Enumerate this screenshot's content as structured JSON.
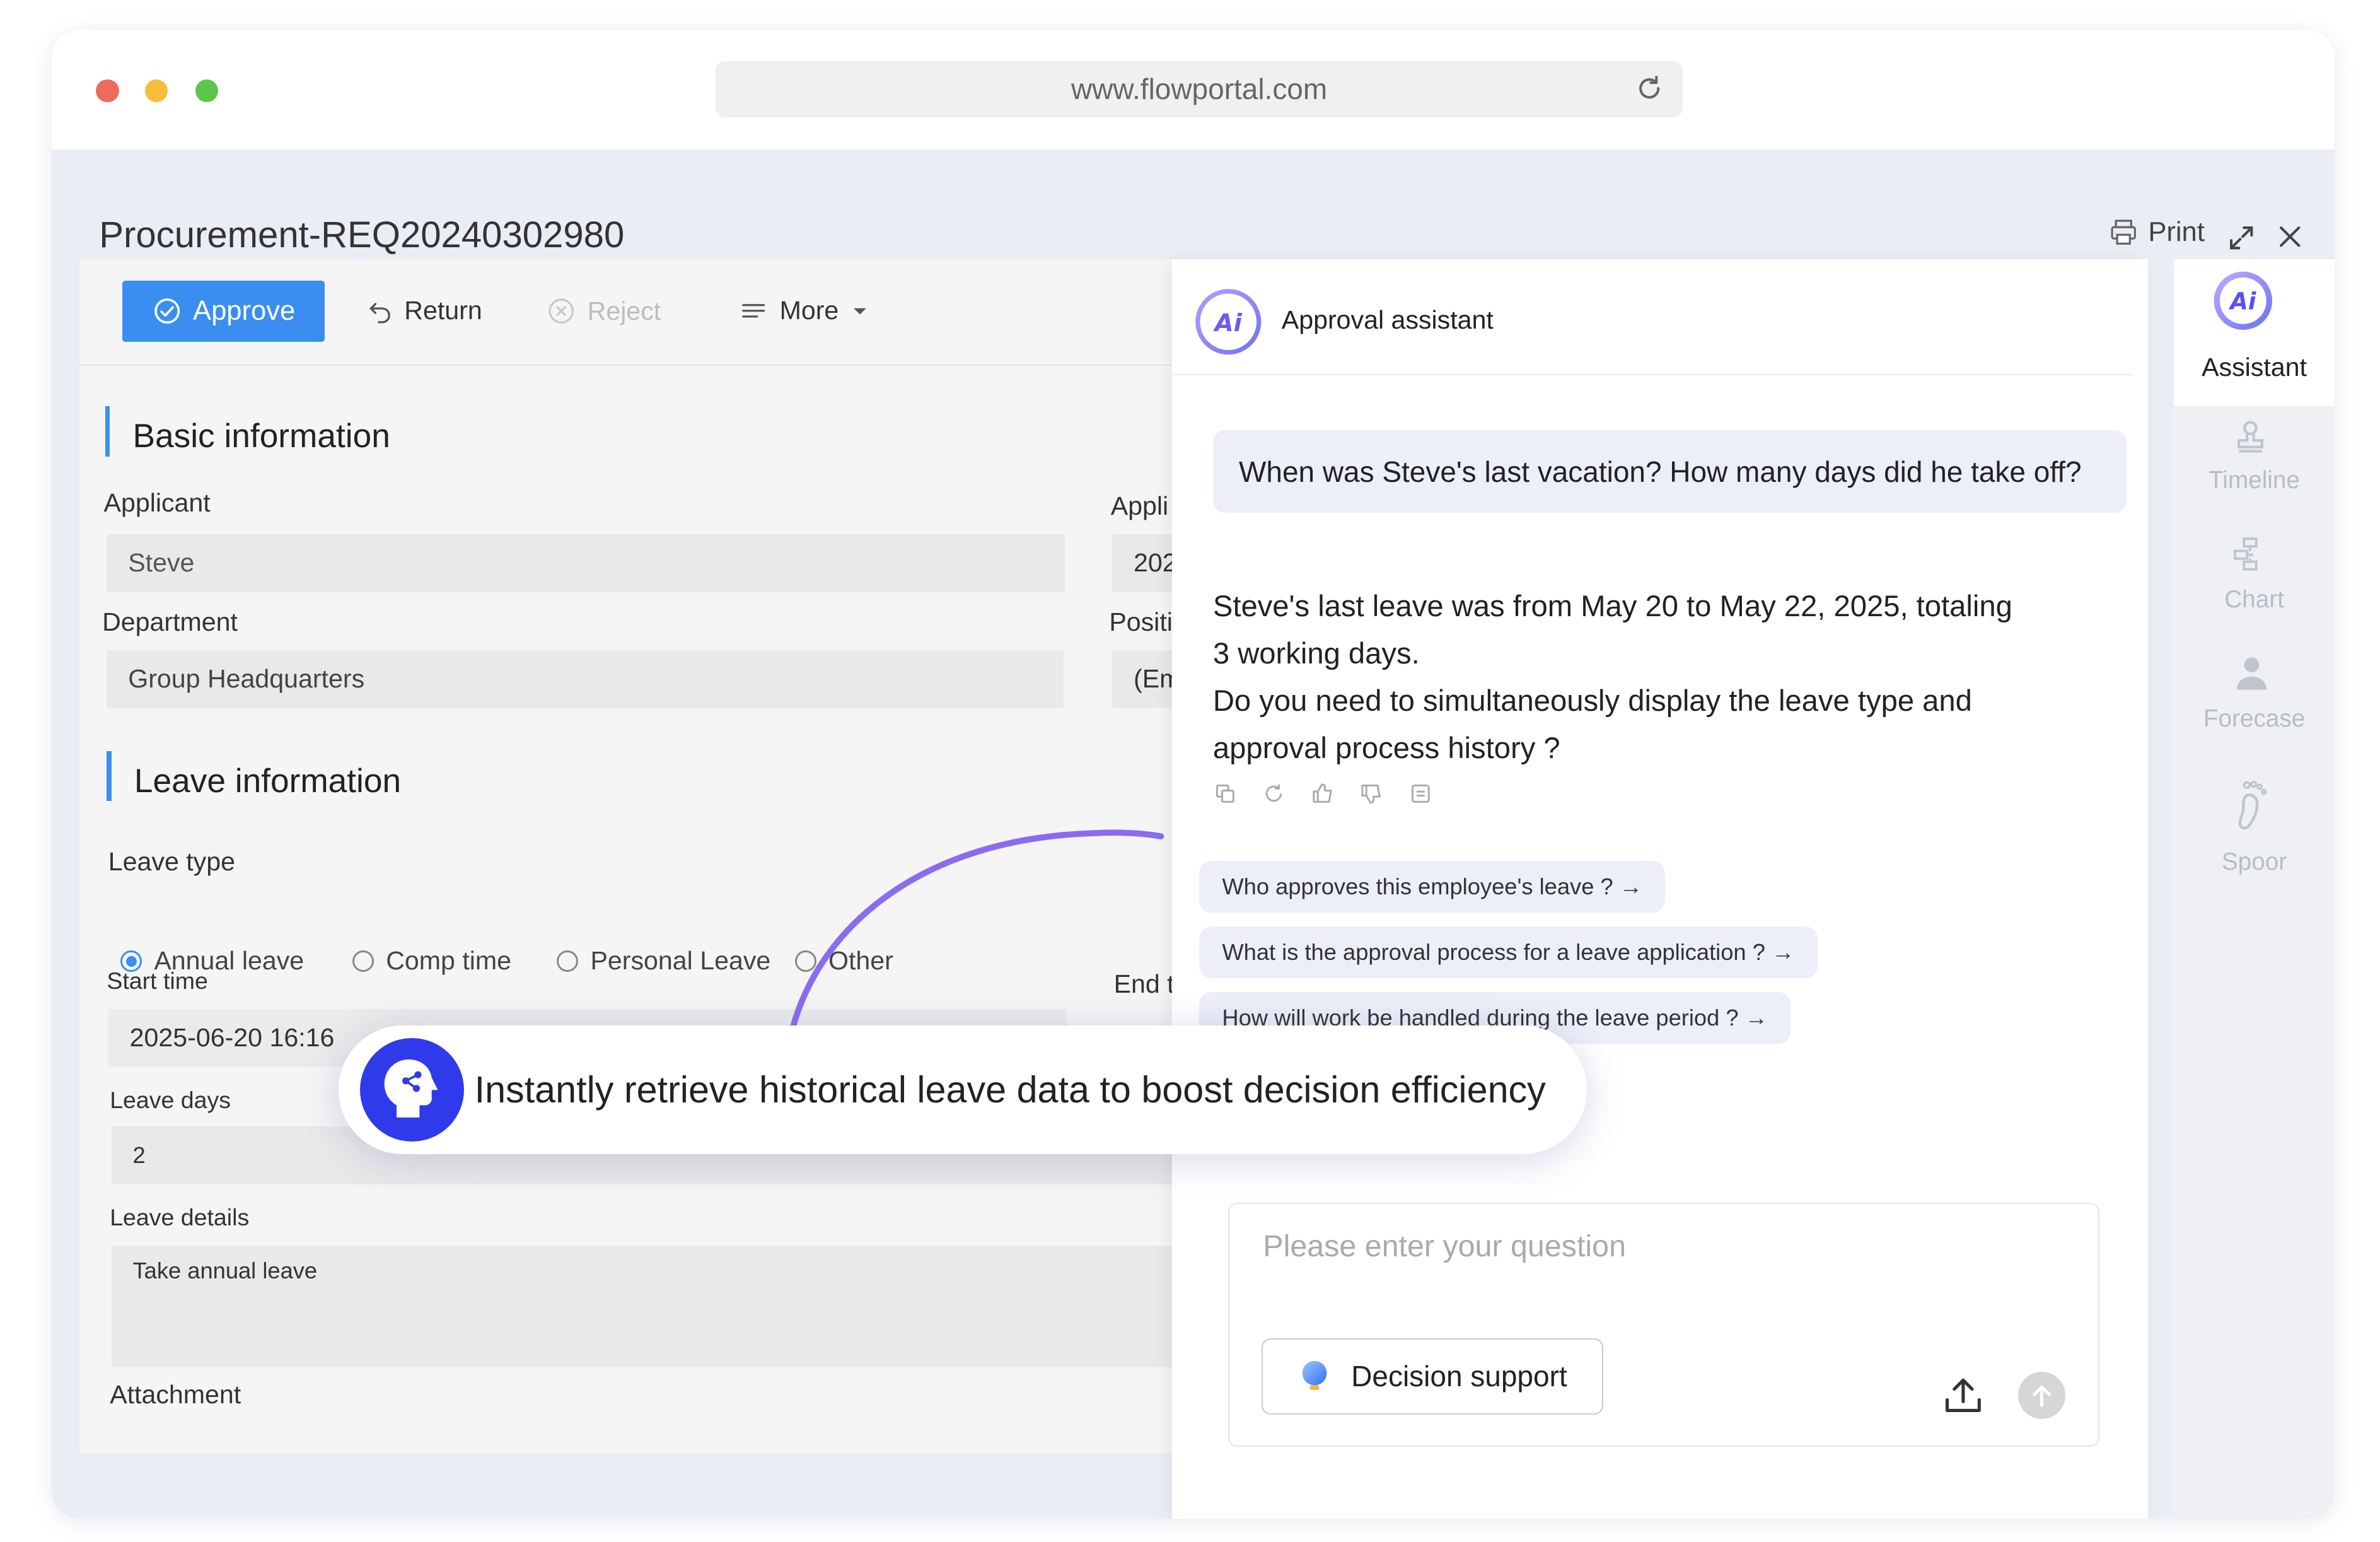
{
  "browser": {
    "url": "www.flowportal.com"
  },
  "header": {
    "title": "Procurement-REQ20240302980",
    "print_label": "Print"
  },
  "toolbar": {
    "approve": "Approve",
    "return": "Return",
    "reject": "Reject",
    "more": "More"
  },
  "basic": {
    "title": "Basic information",
    "applicant_label": "Applicant",
    "applicant_value": "Steve",
    "apply_label_partial": "Appli",
    "apply_value_partial": "202",
    "department_label": "Department",
    "department_value": "Group Headquarters",
    "position_label_partial": "Positi",
    "position_value_partial": "(Em"
  },
  "leave": {
    "title": "Leave information",
    "type_label": "Leave type",
    "types": [
      "Annual leave",
      "Comp time",
      "Personal Leave",
      "Other"
    ],
    "selected_type": "Annual leave",
    "start_label": "Start time",
    "start_value": "2025-06-20 16:16",
    "end_label_partial": "End t",
    "days_label": "Leave days",
    "days_value": "2",
    "details_label": "Leave details",
    "details_value": "Take annual leave",
    "attachment_label": "Attachment"
  },
  "assistant": {
    "title": "Approval assistant",
    "user_question": "When was Steve's last vacation? How many days did he take off?",
    "answer_lines": [
      "Steve's last leave was from May 20 to May 22, 2025, totaling",
      "3 working days.",
      "Do you need to simultaneously display the leave type and",
      "approval process history ?"
    ],
    "suggestions": [
      "Who approves this employee's leave ? →",
      "What is the approval process for a leave application ? →",
      "How will work be handled during the leave period ? →"
    ],
    "input_placeholder": "Please enter your question",
    "decision_support": "Decision support"
  },
  "rail": {
    "items": [
      "Assistant",
      "Timeline",
      "Chart",
      "Forecase",
      "Spoor"
    ]
  },
  "callout": {
    "text": "Instantly retrieve historical leave data to boost decision efficiency"
  },
  "colors": {
    "accent_blue": "#3b8ef0",
    "assistant_purple": "#8b6cf0",
    "callout_icon": "#2f3bea"
  }
}
